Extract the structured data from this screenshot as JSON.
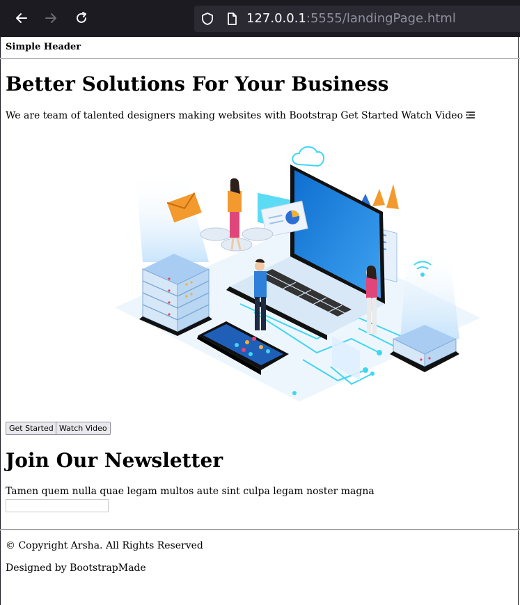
{
  "browser": {
    "url_host": "127.0.0.1",
    "url_rest": ":5555/landingPage.html"
  },
  "header": {
    "title": "Simple Header"
  },
  "hero": {
    "title": "Better Solutions For Your Business",
    "subtitle": "We are team of talented designers making websites with Bootstrap Get Started Watch Video",
    "buttons": {
      "get_started": "Get Started",
      "watch_video": "Watch Video"
    }
  },
  "newsletter": {
    "title": "Join Our Newsletter",
    "text": "Tamen quem nulla quae legam multos aute sint culpa legam noster magna",
    "input_value": ""
  },
  "footer": {
    "copyright": "© Copyright Arsha. All Rights Reserved",
    "credit": "Designed by BootstrapMade"
  },
  "colors": {
    "chrome_bg": "#1c1b22",
    "urlbar_bg": "#2b2a33",
    "accent_blue": "#1a8fe8",
    "accent_cyan": "#3fd6f2"
  },
  "icons": [
    "back-arrow-icon",
    "forward-arrow-icon",
    "reload-icon",
    "shield-icon",
    "page-icon",
    "menu-list-icon"
  ]
}
